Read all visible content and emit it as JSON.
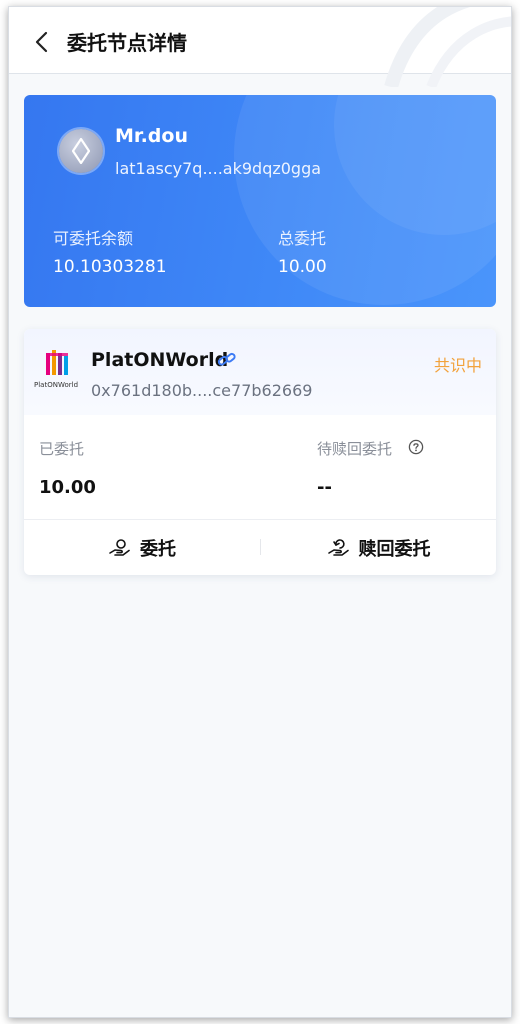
{
  "header": {
    "title": "委托节点详情",
    "back_icon": "chevron-left-icon"
  },
  "account": {
    "name": "Mr.dou",
    "address": "lat1ascy7q....ak9dqz0gga",
    "available_label": "可委托余额",
    "available_value": "10.10303281",
    "total_label": "总委托",
    "total_value": "10.00",
    "card_color": "#3d84f5"
  },
  "node": {
    "name": "PlatONWorld",
    "logo_text": "PlatONWorld",
    "address": "0x761d180b....ce77b62669",
    "status": "共识中",
    "status_color": "#f2a23c",
    "delegated_label": "已委托",
    "delegated_value": "10.00",
    "pending_label": "待赎回委托",
    "pending_value": "--"
  },
  "actions": {
    "delegate_label": "委托",
    "redeem_label": "赎回委托"
  }
}
